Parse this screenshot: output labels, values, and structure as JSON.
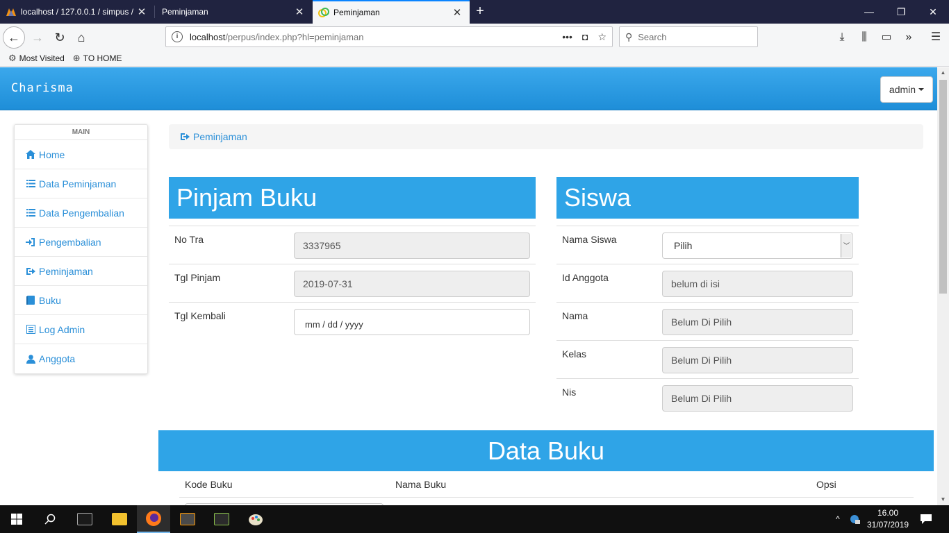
{
  "browser": {
    "tabs": [
      {
        "title": "localhost / 127.0.0.1 / simpus / ..."
      },
      {
        "title": "Peminjaman"
      },
      {
        "title": "Peminjaman"
      }
    ],
    "url_host": "localhost",
    "url_path": "/perpus/index.php?hl=peminjaman",
    "search_placeholder": "Search",
    "bookmarks": [
      {
        "label": "Most Visited",
        "icon": "gear-icon"
      },
      {
        "label": "TO HOME",
        "icon": "globe-icon"
      }
    ]
  },
  "site": {
    "brand": "Charisma",
    "user_menu": "admin"
  },
  "sidebar": {
    "header": "MAIN",
    "items": [
      {
        "label": "Home",
        "icon": "home-icon"
      },
      {
        "label": "Data Peminjaman",
        "icon": "list-icon"
      },
      {
        "label": "Data Pengembalian",
        "icon": "list-icon"
      },
      {
        "label": "Pengembalian",
        "icon": "log-in-icon"
      },
      {
        "label": "Peminjaman",
        "icon": "share-icon"
      },
      {
        "label": "Buku",
        "icon": "book-icon"
      },
      {
        "label": "Log Admin",
        "icon": "list-alt-icon"
      },
      {
        "label": "Anggota",
        "icon": "user-icon"
      }
    ]
  },
  "breadcrumb": {
    "label": "Peminjaman"
  },
  "pinjam": {
    "title": "Pinjam Buku",
    "fields": [
      {
        "label": "No Tra",
        "value": "3337965"
      },
      {
        "label": "Tgl Pinjam",
        "value": "2019-07-31"
      },
      {
        "label": "Tgl Kembali",
        "value": "mm / dd / yyyy"
      }
    ]
  },
  "siswa": {
    "title": "Siswa",
    "fields": [
      {
        "label": "Nama Siswa",
        "value": "Pilih"
      },
      {
        "label": "Id Anggota",
        "value": "belum di isi"
      },
      {
        "label": "Nama",
        "value": "Belum Di Pilih"
      },
      {
        "label": "Kelas",
        "value": "Belum Di Pilih"
      },
      {
        "label": "Nis",
        "value": "Belum Di Pilih"
      }
    ]
  },
  "data_buku": {
    "title": "Data Buku",
    "columns": [
      "Kode Buku",
      "Nama Buku",
      "Opsi"
    ]
  },
  "taskbar": {
    "time": "16.00",
    "date": "31/07/2019"
  },
  "colors": {
    "accent": "#2fa4e7",
    "link": "#2a8fd8",
    "tabbar": "#202340",
    "taskbar": "#101010"
  }
}
